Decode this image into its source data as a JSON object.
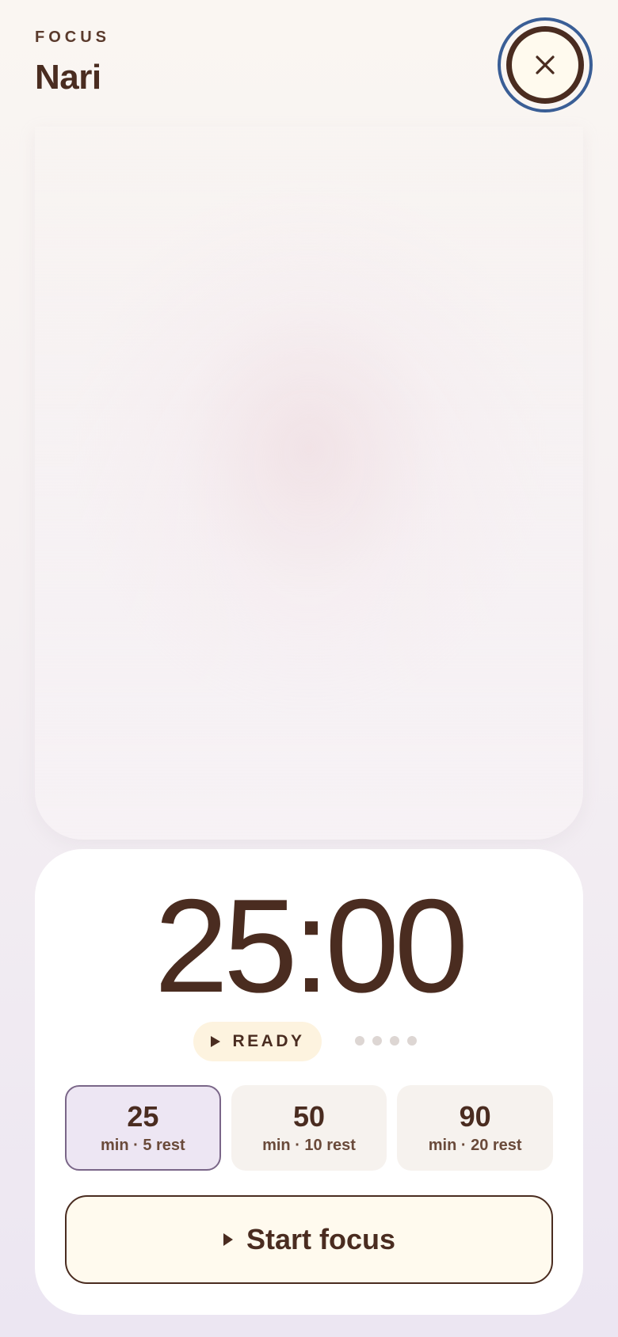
{
  "header": {
    "eyebrow": "FOCUS",
    "title": "Nari"
  },
  "close_button": {
    "icon": "close-icon"
  },
  "timer": {
    "display": "25:00"
  },
  "status": {
    "icon": "play-icon",
    "label": "READY",
    "session_dots_total": 4,
    "session_dots_completed": 0
  },
  "presets": [
    {
      "minutes": "25",
      "detail": "min · 5 rest",
      "selected": true
    },
    {
      "minutes": "50",
      "detail": "min · 10 rest",
      "selected": false
    },
    {
      "minutes": "90",
      "detail": "min · 20 rest",
      "selected": false
    }
  ],
  "start_button": {
    "icon": "play-icon",
    "label": "Start focus"
  },
  "colors": {
    "text": "#4a2c20",
    "focus_ring": "#3a5e96",
    "selected_preset_bg": "#ede6f3",
    "selected_preset_border": "#7a6688",
    "status_pill_bg": "#fdf3df",
    "button_bg": "#fffaee"
  }
}
